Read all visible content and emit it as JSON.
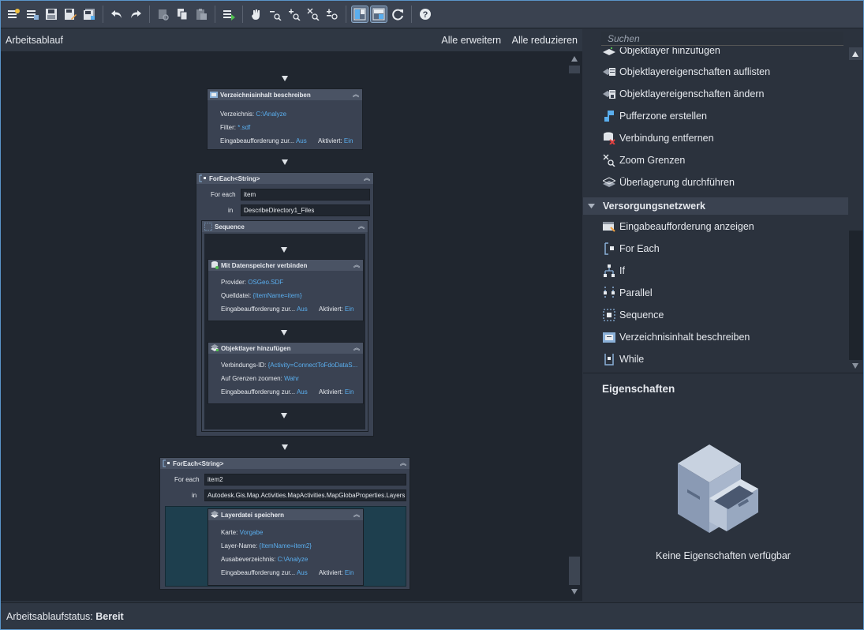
{
  "toolbar": {
    "icons": [
      "new-workflow-icon",
      "open-workflow-icon",
      "save-icon",
      "save-as-icon",
      "save-all-icon",
      "undo-icon",
      "redo-icon",
      "cut-icon",
      "copy-icon",
      "paste-icon",
      "run-icon",
      "pan-icon",
      "zoom-out-icon",
      "zoom-in-icon",
      "zoom-extents-icon",
      "zoom-reset-icon",
      "layout-1-icon",
      "layout-2-icon",
      "refresh-icon",
      "help-icon"
    ]
  },
  "workflow": {
    "title": "Arbeitsablauf",
    "expand_all": "Alle erweitern",
    "collapse_all": "Alle reduzieren"
  },
  "activities": {
    "describe_dir": {
      "title": "Verzeichnisinhalt beschreiben",
      "dir_label": "Verzeichnis:",
      "dir_value": "C:\\Analyze",
      "filter_label": "Filter:",
      "filter_value": "*.sdf",
      "prompt_label": "Eingabeaufforderung zur...",
      "prompt_value": "Aus",
      "enabled_label": "Aktiviert:",
      "enabled_value": "Ein"
    },
    "foreach1": {
      "title": "ForEach<String>",
      "for_each_label": "For each",
      "for_each_value": "item",
      "in_label": "in",
      "in_value": "DescribeDirectory1_Files",
      "sequence_title": "Sequence"
    },
    "connect": {
      "title": "Mit Datenspeicher verbinden",
      "provider_label": "Provider:",
      "provider_value": "OSGeo.SDF",
      "source_label": "Quelldatei:",
      "source_value": "{ItemName=item}",
      "prompt_label": "Eingabeaufforderung zur...",
      "prompt_value": "Aus",
      "enabled_label": "Aktiviert:",
      "enabled_value": "Ein"
    },
    "add_layer": {
      "title": "Objektlayer hinzufügen",
      "conn_label": "Verbindungs-ID:",
      "conn_value": "{Activity=ConnectToFdoDataS...",
      "zoom_label": "Auf Grenzen zoomen:",
      "zoom_value": "Wahr",
      "prompt_label": "Eingabeaufforderung zur...",
      "prompt_value": "Aus",
      "enabled_label": "Aktiviert:",
      "enabled_value": "Ein"
    },
    "foreach2": {
      "title": "ForEach<String>",
      "for_each_label": "For each",
      "for_each_value": "item2",
      "in_label": "in",
      "in_value": "Autodesk.Gis.Map.Activities.MapActivities.MapGlobaProperties.Layers"
    },
    "save_layer": {
      "title": "Layerdatei speichern",
      "map_label": "Karte:",
      "map_value": "Vorgabe",
      "layer_label": "Layer-Name:",
      "layer_value": "{ItemName=item2}",
      "outdir_label": "Ausabeverzeichnis:",
      "outdir_value": "C:\\Analyze",
      "prompt_label": "Eingabeaufforderung zur...",
      "prompt_value": "Aus",
      "enabled_label": "Aktiviert:",
      "enabled_value": "Ein"
    }
  },
  "toolbox": {
    "search_placeholder": "Suchen",
    "items_top": [
      {
        "label": "Objektlayer hinzufügen",
        "icon": "add-layer-icon"
      },
      {
        "label": "Objektlayereigenschaften auflisten",
        "icon": "list-layer-props-icon"
      },
      {
        "label": "Objektlayereigenschaften ändern",
        "icon": "change-layer-props-icon"
      },
      {
        "label": "Pufferzone erstellen",
        "icon": "buffer-icon"
      },
      {
        "label": "Verbindung entfernen",
        "icon": "remove-connection-icon"
      },
      {
        "label": "Zoom Grenzen",
        "icon": "zoom-extents-icon"
      },
      {
        "label": "Überlagerung durchführen",
        "icon": "overlay-icon"
      }
    ],
    "section": "Versorgungsnetzwerk",
    "items_section": [
      {
        "label": "Eingabeaufforderung anzeigen",
        "icon": "prompt-icon"
      },
      {
        "label": "For Each",
        "icon": "foreach-icon"
      },
      {
        "label": "If",
        "icon": "if-icon"
      },
      {
        "label": "Parallel",
        "icon": "parallel-icon"
      },
      {
        "label": "Sequence",
        "icon": "sequence-icon"
      },
      {
        "label": "Verzeichnisinhalt beschreiben",
        "icon": "describe-dir-icon"
      },
      {
        "label": "While",
        "icon": "while-icon"
      }
    ]
  },
  "properties": {
    "title": "Eigenschaften",
    "empty_text": "Keine Eigenschaften verfügbar"
  },
  "status": {
    "label": "Arbeitsablaufstatus:",
    "value": "Bereit"
  }
}
